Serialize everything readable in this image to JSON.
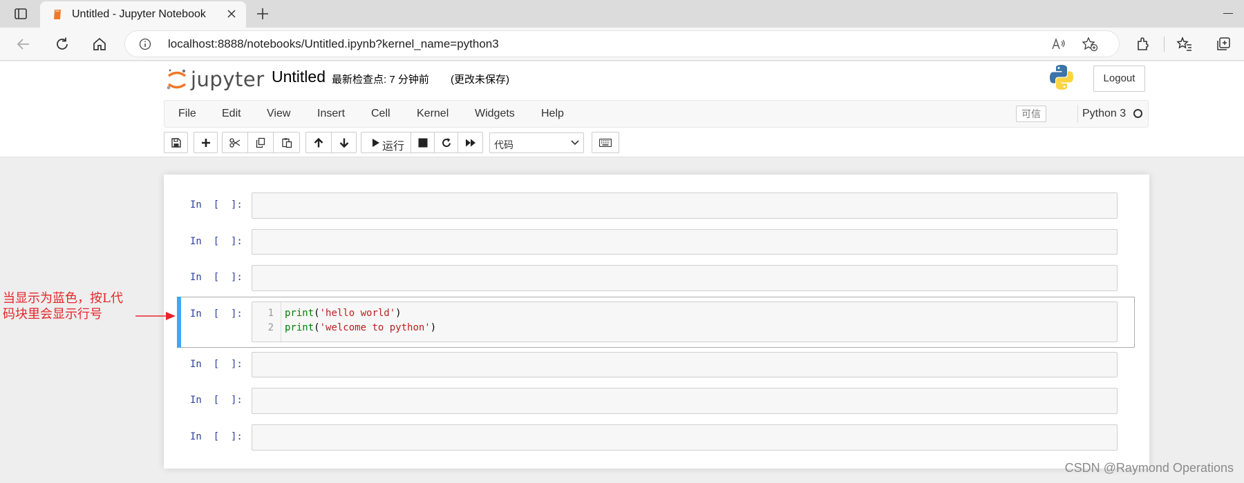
{
  "browser": {
    "tab_title": "Untitled - Jupyter Notebook",
    "url": "localhost:8888/notebooks/Untitled.ipynb?kernel_name=python3"
  },
  "jupyter": {
    "logo_text": "jupyter",
    "notebook_title": "Untitled",
    "checkpoint_text": "最新检查点: 7 分钟前",
    "unsaved_text": "(更改未保存)",
    "logout_label": "Logout",
    "menu": [
      "File",
      "Edit",
      "View",
      "Insert",
      "Cell",
      "Kernel",
      "Widgets",
      "Help"
    ],
    "trusted_label": "可信",
    "kernel_name": "Python 3",
    "run_label": "运行",
    "cell_type_selected": "代码"
  },
  "cells": [
    {
      "prompt": "In  [  ]:",
      "lines": []
    },
    {
      "prompt": "In  [  ]:",
      "lines": []
    },
    {
      "prompt": "In  [  ]:",
      "lines": []
    },
    {
      "prompt": "In  [  ]:",
      "selected": true,
      "line_numbers": [
        "1",
        "2"
      ],
      "lines": [
        {
          "fn": "print",
          "open": "(",
          "str": "'hello world'",
          "close": ")"
        },
        {
          "fn": "print",
          "open": "(",
          "str": "'welcome to python'",
          "close": ")"
        }
      ]
    },
    {
      "prompt": "In  [  ]:",
      "lines": []
    },
    {
      "prompt": "In  [  ]:",
      "lines": []
    },
    {
      "prompt": "In  [  ]:",
      "lines": []
    }
  ],
  "annotation": {
    "line1": "当显示为蓝色，按L代",
    "line2": "码块里会显示行号",
    "color": "#e5262b"
  },
  "watermark": "CSDN @Raymond Operations",
  "colors": {
    "prompt": "#303f9f",
    "selected_bar": "#42a5f5",
    "builtin": "#008000",
    "string": "#ba2121"
  }
}
